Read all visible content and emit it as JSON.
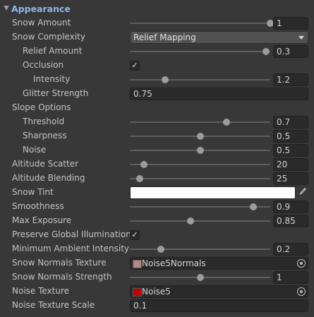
{
  "section": {
    "title": "Appearance"
  },
  "rows": {
    "snow_amount": {
      "label": "Snow Amount",
      "value": "1",
      "slider_fraction": 1.0
    },
    "snow_complexity": {
      "label": "Snow Complexity",
      "selected": "Relief Mapping"
    },
    "relief_amount": {
      "label": "Relief Amount",
      "value": "0.3",
      "slider_fraction": 0.97
    },
    "occlusion": {
      "label": "Occlusion",
      "checked": "✓"
    },
    "intensity": {
      "label": "Intensity",
      "value": "1.2",
      "slider_fraction": 0.25
    },
    "glitter_strength": {
      "label": "Glitter Strength",
      "value": "0.75"
    },
    "slope_options": {
      "label": "Slope Options"
    },
    "threshold": {
      "label": "Threshold",
      "value": "0.7",
      "slider_fraction": 0.69
    },
    "sharpness": {
      "label": "Sharpness",
      "value": "0.5",
      "slider_fraction": 0.5
    },
    "noise": {
      "label": "Noise",
      "value": "0.5",
      "slider_fraction": 0.5
    },
    "altitude_scatter": {
      "label": "Altitude Scatter",
      "value": "20",
      "slider_fraction": 0.1
    },
    "altitude_blending": {
      "label": "Altitude Blending",
      "value": "25",
      "slider_fraction": 0.07
    },
    "snow_tint": {
      "label": "Snow Tint",
      "color": "#ffffff"
    },
    "smoothness": {
      "label": "Smoothness",
      "value": "0.9",
      "slider_fraction": 0.88
    },
    "max_exposure": {
      "label": "Max Exposure",
      "value": "0.85",
      "slider_fraction": 0.43
    },
    "preserve_gi": {
      "label": "Preserve Global Illumination",
      "checked": "✓"
    },
    "min_ambient": {
      "label": "Minimum Ambient Intensity",
      "value": "0.2",
      "slider_fraction": 0.22
    },
    "snow_normals_texture": {
      "label": "Snow Normals Texture",
      "object": "Noise5Normals",
      "swatch_color": "#b08a8a"
    },
    "snow_normals_strength": {
      "label": "Snow Normals Strength",
      "value": "1",
      "slider_fraction": 0.5
    },
    "noise_texture": {
      "label": "Noise Texture",
      "object": "Noise5",
      "swatch_color": "#c40000"
    },
    "noise_texture_scale": {
      "label": "Noise Texture Scale",
      "value": "0.1"
    }
  },
  "icons": {
    "foldout": "triangle-down-icon",
    "dropdown": "chevron-down-icon",
    "eyedropper": "eyedropper-icon",
    "object_picker": "target-icon"
  }
}
